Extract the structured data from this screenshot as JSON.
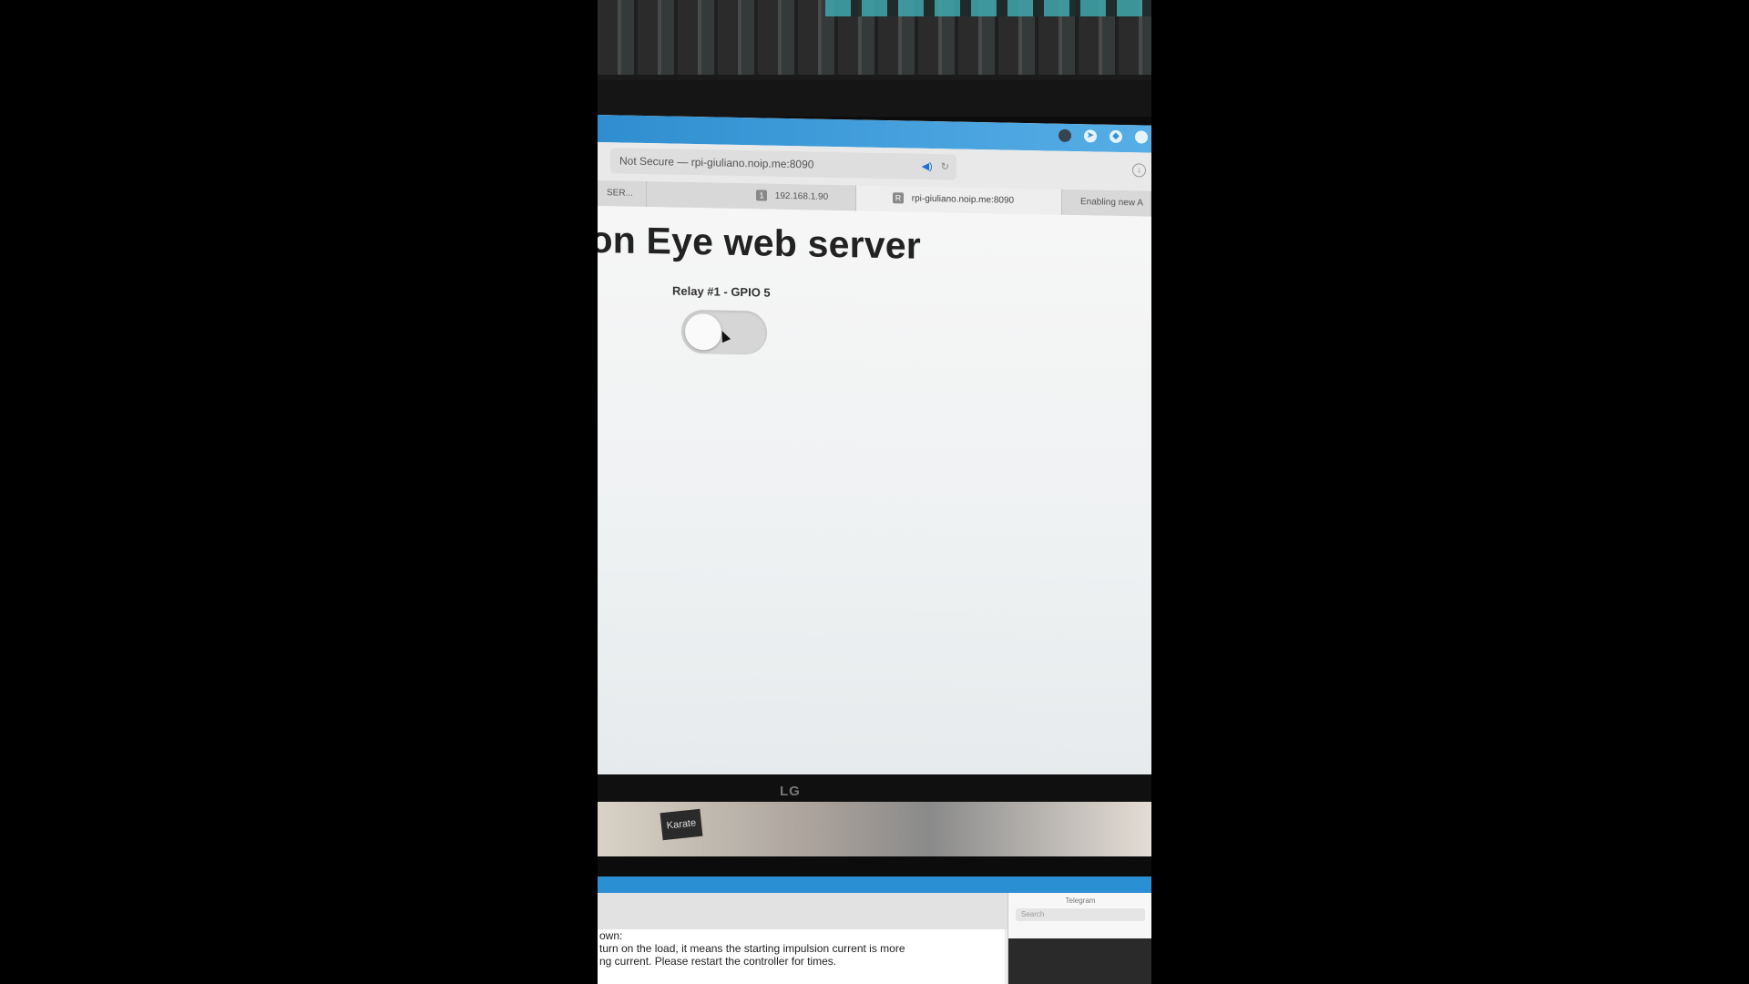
{
  "browser": {
    "address_bar": "Not Secure — rpi-giuliano.noip.me:8090",
    "tabs": [
      {
        "label": "SER...",
        "favicon": ""
      },
      {
        "label": "192.168.1.90",
        "favicon": "1"
      },
      {
        "label": "rpi-giuliano.noip.me:8090",
        "favicon": "R"
      },
      {
        "label": "Enabling new A",
        "favicon": ""
      }
    ]
  },
  "page": {
    "title": "tion Eye web server",
    "relay_label": "Relay #1 - GPIO 5",
    "relay_state": "off"
  },
  "monitor": {
    "brand": "LG"
  },
  "desk": {
    "box_label": "Karate"
  },
  "laptop": {
    "doc_lines": [
      "own:",
      "turn on the load, it means the starting impulsion current is more",
      "ng current. Please restart the controller for times."
    ],
    "telegram_title": "Telegram",
    "search_placeholder": "Search"
  },
  "colors": {
    "menubar": "#2f8ed0",
    "toggle_off": "#d6d6d6"
  }
}
